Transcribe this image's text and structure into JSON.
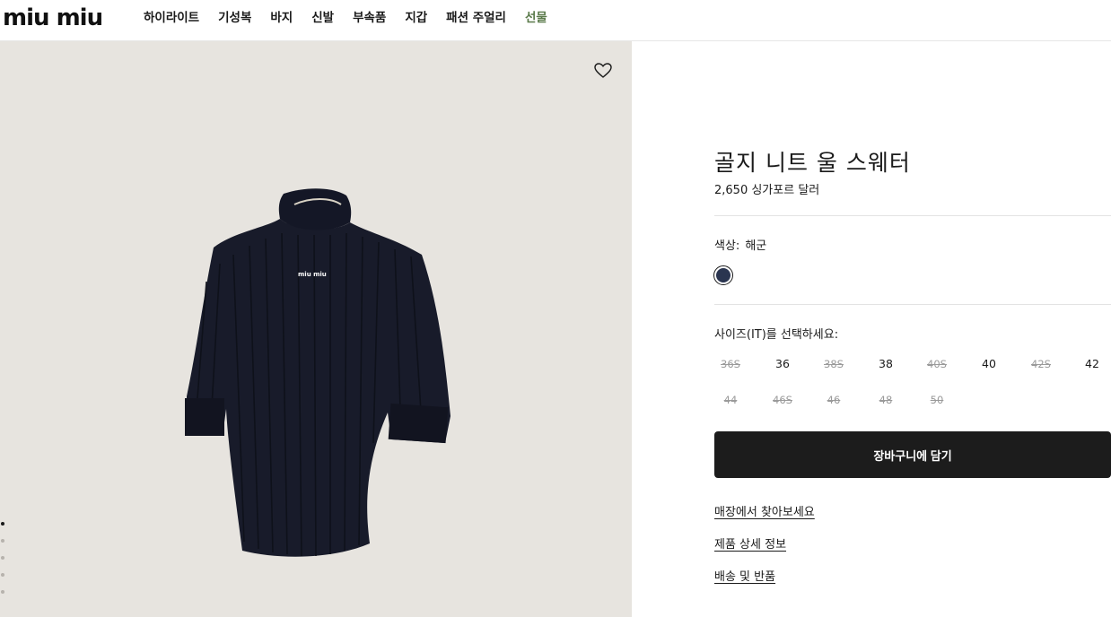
{
  "header": {
    "logo": "miu miu",
    "nav": [
      "하이라이트",
      "기성복",
      "바지",
      "신발",
      "부속품",
      "지갑",
      "패션 주얼리",
      "선물"
    ]
  },
  "gallery": {
    "wishlist_icon": "heart-outline-icon",
    "logo_on_garment": "miu miu"
  },
  "product": {
    "title": "골지 니트 울 스웨터",
    "price": "2,650 싱가포르 달러",
    "color_label": "색상:",
    "color_value": "해군",
    "swatch_color": "#2a3550",
    "size_label": "사이즈(IT)를 선택하세요:",
    "sizes": [
      {
        "label": "36S",
        "available": false
      },
      {
        "label": "36",
        "available": true
      },
      {
        "label": "38S",
        "available": false
      },
      {
        "label": "38",
        "available": true
      },
      {
        "label": "40S",
        "available": false
      },
      {
        "label": "40",
        "available": true
      },
      {
        "label": "42S",
        "available": false
      },
      {
        "label": "42",
        "available": true
      },
      {
        "label": "44",
        "available": false
      },
      {
        "label": "46S",
        "available": false
      },
      {
        "label": "46",
        "available": false
      },
      {
        "label": "48",
        "available": false
      },
      {
        "label": "50",
        "available": false
      }
    ],
    "cart_button": "장바구니에 담기",
    "links": [
      "매장에서 찾아보세요",
      "제품 상세 정보",
      "배송 및 반품"
    ]
  }
}
